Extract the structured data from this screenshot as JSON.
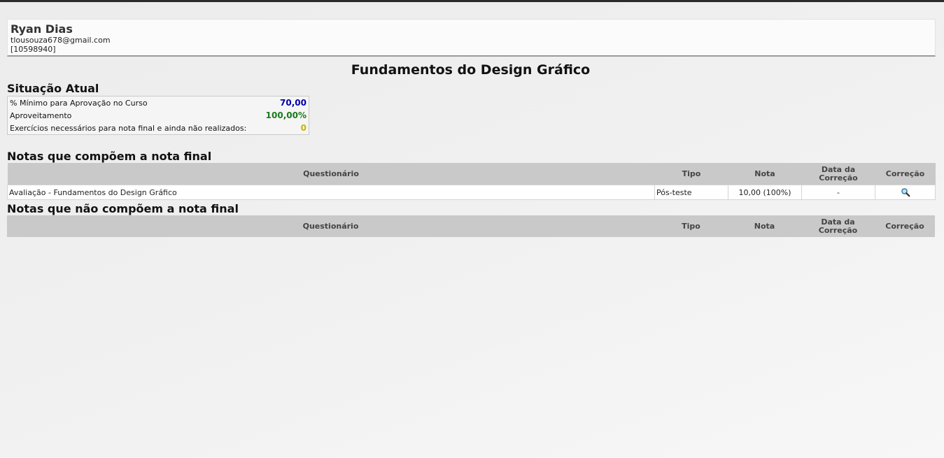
{
  "user": {
    "name": "Ryan Dias",
    "email": "tlousouza678@gmail.com",
    "id": "[10598940]"
  },
  "course_title": "Fundamentos do Design Gráfico",
  "status": {
    "heading": "Situação Atual",
    "rows": [
      {
        "label": "% Mínimo para Aprovação no Curso",
        "value": "70,00",
        "color": "#0000aa"
      },
      {
        "label": "Aproveitamento",
        "value": "100,00%",
        "color": "#1a7a1a"
      },
      {
        "label": "Exercícios necessários para nota final e ainda não realizados:",
        "value": "0",
        "color": "#c8b400"
      }
    ]
  },
  "table_headers": {
    "questionario": "Questionário",
    "tipo": "Tipo",
    "nota": "Nota",
    "data_correcao_line1": "Data da",
    "data_correcao_line2": "Correção",
    "correcao": "Correção"
  },
  "final_grades": {
    "heading": "Notas que compõem a nota final",
    "rows": [
      {
        "questionario": "Avaliação - Fundamentos do Design Gráfico",
        "tipo": "Pós-teste",
        "nota": "10,00 (100%)",
        "data_correcao": "-",
        "correcao_icon": "magnifier-icon"
      }
    ]
  },
  "non_final_grades": {
    "heading": "Notas que não compõem a nota final",
    "rows": []
  }
}
